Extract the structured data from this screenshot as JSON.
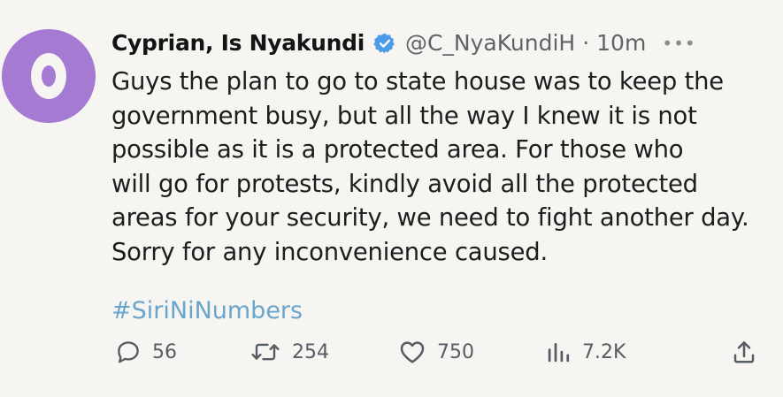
{
  "tweet": {
    "display_name": "Cyprian, Is Nyakundi",
    "handle": "@C_NyaKundiH",
    "separator": "·",
    "time": "10m",
    "more": "•••",
    "text_lines": [
      "Guys the plan to go to state house was to keep the",
      "government busy, but all the way I knew it is not",
      "possible as it is a protected area. For those who",
      "will go for protests, kindly avoid all the protected",
      "areas for your security, we need to fight another day.",
      "Sorry for any inconvenience caused."
    ],
    "hashtag": "#SiriNiNumbers"
  },
  "actions": {
    "replies": "56",
    "retweets": "254",
    "likes": "750",
    "views": "7.2K"
  },
  "icons": {
    "avatar": "avatar-icon",
    "verified": "verified-badge-icon",
    "reply": "reply-icon",
    "retweet": "retweet-icon",
    "like": "heart-icon",
    "views": "views-icon",
    "share": "share-icon"
  },
  "colors": {
    "avatar": "#a57ad3",
    "verified": "#4b9be8",
    "hashtag": "#6aa6cc",
    "background": "#f6f5f2"
  }
}
